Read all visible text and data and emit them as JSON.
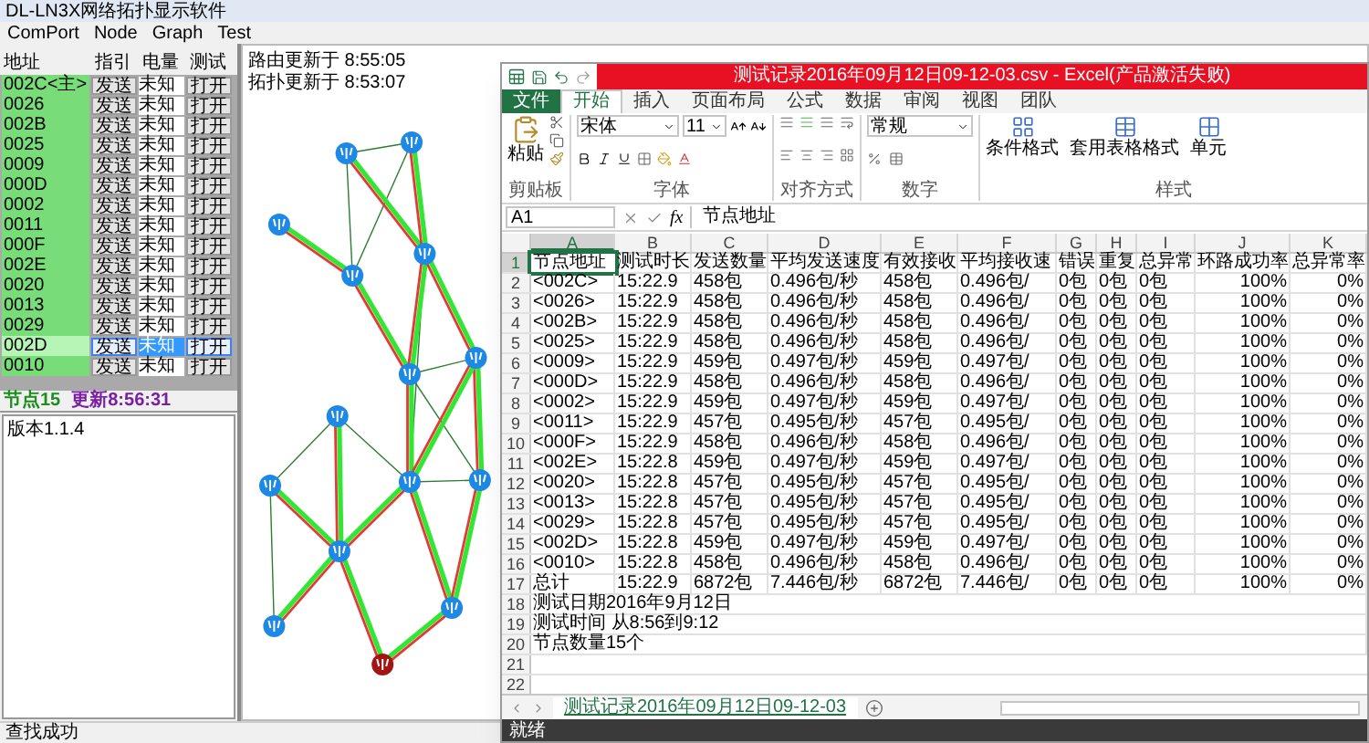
{
  "window": {
    "title": "DL-LN3X网络拓扑显示软件"
  },
  "menu": [
    "ComPort",
    "Node",
    "Graph",
    "Test"
  ],
  "node_table": {
    "columns": [
      "地址",
      "指引",
      "电量",
      "测试"
    ],
    "rows": [
      {
        "address": "002C<主>",
        "send": "发送",
        "battery": "未知",
        "test": "打开",
        "selected": false
      },
      {
        "address": "0026",
        "send": "发送",
        "battery": "未知",
        "test": "打开",
        "selected": false
      },
      {
        "address": "002B",
        "send": "发送",
        "battery": "未知",
        "test": "打开",
        "selected": false
      },
      {
        "address": "0025",
        "send": "发送",
        "battery": "未知",
        "test": "打开",
        "selected": false
      },
      {
        "address": "0009",
        "send": "发送",
        "battery": "未知",
        "test": "打开",
        "selected": false
      },
      {
        "address": "000D",
        "send": "发送",
        "battery": "未知",
        "test": "打开",
        "selected": false
      },
      {
        "address": "0002",
        "send": "发送",
        "battery": "未知",
        "test": "打开",
        "selected": false
      },
      {
        "address": "0011",
        "send": "发送",
        "battery": "未知",
        "test": "打开",
        "selected": false
      },
      {
        "address": "000F",
        "send": "发送",
        "battery": "未知",
        "test": "打开",
        "selected": false
      },
      {
        "address": "002E",
        "send": "发送",
        "battery": "未知",
        "test": "打开",
        "selected": false
      },
      {
        "address": "0020",
        "send": "发送",
        "battery": "未知",
        "test": "打开",
        "selected": false
      },
      {
        "address": "0013",
        "send": "发送",
        "battery": "未知",
        "test": "打开",
        "selected": false
      },
      {
        "address": "0029",
        "send": "发送",
        "battery": "未知",
        "test": "打开",
        "selected": false
      },
      {
        "address": "002D",
        "send": "发送",
        "battery": "未知",
        "test": "打开",
        "selected": true
      },
      {
        "address": "0010",
        "send": "发送",
        "battery": "未知",
        "test": "打开",
        "selected": false
      }
    ]
  },
  "node_status": {
    "count": "节点15",
    "updated": "更新8:56:31"
  },
  "log": [
    "版本1.1.4"
  ],
  "graph": {
    "route_updated": "路由更新于 8:55:05",
    "topology_updated": "拓扑更新于 8:53:07"
  },
  "status_bar": "查找成功",
  "excel": {
    "title": "测试记录2016年09月12日09-12-03.csv - Excel(产品激活失败)",
    "tabs": [
      {
        "label": "文件",
        "kind": "file",
        "selected": false
      },
      {
        "label": "开始",
        "kind": "tab",
        "selected": true
      },
      {
        "label": "插入",
        "kind": "tab",
        "selected": false
      },
      {
        "label": "页面布局",
        "kind": "tab",
        "selected": false
      },
      {
        "label": "公式",
        "kind": "tab",
        "selected": false
      },
      {
        "label": "数据",
        "kind": "tab",
        "selected": false
      },
      {
        "label": "审阅",
        "kind": "tab",
        "selected": false
      },
      {
        "label": "视图",
        "kind": "tab",
        "selected": false
      },
      {
        "label": "团队",
        "kind": "tab",
        "selected": false
      }
    ],
    "ribbon": {
      "paste": "粘贴",
      "font_name": "宋体",
      "font_size": "11",
      "number_format": "常规",
      "conditional_format": "条件格式",
      "table_format": "套用表格格式",
      "cell_styles": "单元",
      "groups": [
        "剪贴板",
        "字体",
        "对齐方式",
        "数字",
        "样式"
      ]
    },
    "name_box": "A1",
    "formula_label": "fx",
    "formula": "节点地址",
    "columns": [
      {
        "label": "A",
        "selected": true
      },
      {
        "label": "B",
        "selected": false
      },
      {
        "label": "C",
        "selected": false
      },
      {
        "label": "D",
        "selected": false
      },
      {
        "label": "E",
        "selected": false
      },
      {
        "label": "F",
        "selected": false
      },
      {
        "label": "G",
        "selected": false
      },
      {
        "label": "H",
        "selected": false
      },
      {
        "label": "I",
        "selected": false
      },
      {
        "label": "J",
        "selected": false
      },
      {
        "label": "K",
        "selected": false
      }
    ],
    "rows": [
      {
        "number": "1",
        "selected": true,
        "cells": [
          "节点地址",
          "测试时长",
          "发送数量",
          "平均发送速度",
          "有效接收",
          "平均接收速",
          "错误",
          "重复",
          "总异常",
          "环路成功率",
          "总异常率"
        ]
      },
      {
        "number": "2",
        "selected": false,
        "cells": [
          "<002C>",
          "15:22.9",
          "458包",
          "0.496包/秒",
          "458包",
          "0.496包/",
          "0包",
          "0包",
          "0包",
          "100%",
          "0%"
        ]
      },
      {
        "number": "3",
        "selected": false,
        "cells": [
          "<0026>",
          "15:22.9",
          "458包",
          "0.496包/秒",
          "458包",
          "0.496包/",
          "0包",
          "0包",
          "0包",
          "100%",
          "0%"
        ]
      },
      {
        "number": "4",
        "selected": false,
        "cells": [
          "<002B>",
          "15:22.9",
          "458包",
          "0.496包/秒",
          "458包",
          "0.496包/",
          "0包",
          "0包",
          "0包",
          "100%",
          "0%"
        ]
      },
      {
        "number": "5",
        "selected": false,
        "cells": [
          "<0025>",
          "15:22.9",
          "458包",
          "0.496包/秒",
          "458包",
          "0.496包/",
          "0包",
          "0包",
          "0包",
          "100%",
          "0%"
        ]
      },
      {
        "number": "6",
        "selected": false,
        "cells": [
          "<0009>",
          "15:22.9",
          "459包",
          "0.497包/秒",
          "459包",
          "0.497包/",
          "0包",
          "0包",
          "0包",
          "100%",
          "0%"
        ]
      },
      {
        "number": "7",
        "selected": false,
        "cells": [
          "<000D>",
          "15:22.9",
          "458包",
          "0.496包/秒",
          "458包",
          "0.496包/",
          "0包",
          "0包",
          "0包",
          "100%",
          "0%"
        ]
      },
      {
        "number": "8",
        "selected": false,
        "cells": [
          "<0002>",
          "15:22.9",
          "459包",
          "0.497包/秒",
          "459包",
          "0.497包/",
          "0包",
          "0包",
          "0包",
          "100%",
          "0%"
        ]
      },
      {
        "number": "9",
        "selected": false,
        "cells": [
          "<0011>",
          "15:22.9",
          "457包",
          "0.495包/秒",
          "457包",
          "0.495包/",
          "0包",
          "0包",
          "0包",
          "100%",
          "0%"
        ]
      },
      {
        "number": "10",
        "selected": false,
        "cells": [
          "<000F>",
          "15:22.9",
          "458包",
          "0.496包/秒",
          "458包",
          "0.496包/",
          "0包",
          "0包",
          "0包",
          "100%",
          "0%"
        ]
      },
      {
        "number": "11",
        "selected": false,
        "cells": [
          "<002E>",
          "15:22.8",
          "459包",
          "0.497包/秒",
          "459包",
          "0.497包/",
          "0包",
          "0包",
          "0包",
          "100%",
          "0%"
        ]
      },
      {
        "number": "12",
        "selected": false,
        "cells": [
          "<0020>",
          "15:22.8",
          "457包",
          "0.495包/秒",
          "457包",
          "0.495包/",
          "0包",
          "0包",
          "0包",
          "100%",
          "0%"
        ]
      },
      {
        "number": "13",
        "selected": false,
        "cells": [
          "<0013>",
          "15:22.8",
          "457包",
          "0.495包/秒",
          "457包",
          "0.495包/",
          "0包",
          "0包",
          "0包",
          "100%",
          "0%"
        ]
      },
      {
        "number": "14",
        "selected": false,
        "cells": [
          "<0029>",
          "15:22.8",
          "457包",
          "0.495包/秒",
          "457包",
          "0.495包/",
          "0包",
          "0包",
          "0包",
          "100%",
          "0%"
        ]
      },
      {
        "number": "15",
        "selected": false,
        "cells": [
          "<002D>",
          "15:22.8",
          "459包",
          "0.497包/秒",
          "459包",
          "0.497包/",
          "0包",
          "0包",
          "0包",
          "100%",
          "0%"
        ]
      },
      {
        "number": "16",
        "selected": false,
        "cells": [
          "<0010>",
          "15:22.8",
          "458包",
          "0.496包/秒",
          "458包",
          "0.496包/",
          "0包",
          "0包",
          "0包",
          "100%",
          "0%"
        ]
      },
      {
        "number": "17",
        "selected": false,
        "cells": [
          "总计",
          "15:22.9",
          "6872包",
          "7.446包/秒",
          "6872包",
          "7.446包/",
          "0包",
          "0包",
          "0包",
          "100%",
          "0%"
        ]
      },
      {
        "number": "18",
        "selected": false,
        "cells": [
          "测试日期2016年9月12日"
        ]
      },
      {
        "number": "19",
        "selected": false,
        "cells": [
          "测试时间 从8:56到9:12"
        ]
      },
      {
        "number": "20",
        "selected": false,
        "cells": [
          "节点数量15个"
        ]
      },
      {
        "number": "21",
        "selected": false,
        "cells": []
      },
      {
        "number": "22",
        "selected": false,
        "cells": []
      }
    ],
    "sheet_tabs": [
      {
        "label": "测试记录2016年09月12日09-12-03",
        "selected": true
      }
    ],
    "status": "就绪"
  }
}
